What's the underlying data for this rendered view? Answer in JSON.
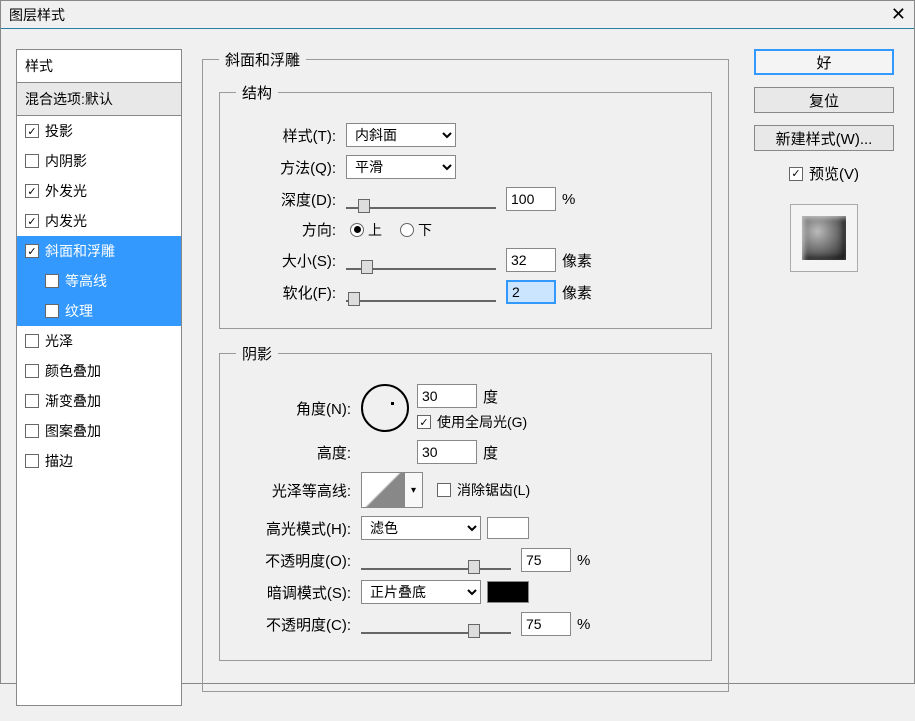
{
  "title": "图层样式",
  "stylesList": {
    "header": "样式",
    "blend": "混合选项:默认",
    "items": [
      {
        "label": "投影",
        "checked": true,
        "selected": false,
        "sub": false
      },
      {
        "label": "内阴影",
        "checked": false,
        "selected": false,
        "sub": false
      },
      {
        "label": "外发光",
        "checked": true,
        "selected": false,
        "sub": false
      },
      {
        "label": "内发光",
        "checked": true,
        "selected": false,
        "sub": false
      },
      {
        "label": "斜面和浮雕",
        "checked": true,
        "selected": true,
        "sub": false
      },
      {
        "label": "等高线",
        "checked": false,
        "selected": true,
        "sub": true
      },
      {
        "label": "纹理",
        "checked": false,
        "selected": true,
        "sub": true
      },
      {
        "label": "光泽",
        "checked": false,
        "selected": false,
        "sub": false
      },
      {
        "label": "颜色叠加",
        "checked": false,
        "selected": false,
        "sub": false
      },
      {
        "label": "渐变叠加",
        "checked": false,
        "selected": false,
        "sub": false
      },
      {
        "label": "图案叠加",
        "checked": false,
        "selected": false,
        "sub": false
      },
      {
        "label": "描边",
        "checked": false,
        "selected": false,
        "sub": false
      }
    ]
  },
  "bevel": {
    "title": "斜面和浮雕",
    "structure": {
      "title": "结构",
      "styleLabel": "样式(T):",
      "styleValue": "内斜面",
      "techLabel": "方法(Q):",
      "techValue": "平滑",
      "depthLabel": "深度(D):",
      "depthValue": "100",
      "depthUnit": "%",
      "directionLabel": "方向:",
      "upLabel": "上",
      "downLabel": "下",
      "sizeLabel": "大小(S):",
      "sizeValue": "32",
      "sizeUnit": "像素",
      "softLabel": "软化(F):",
      "softValue": "2",
      "softUnit": "像素"
    },
    "shading": {
      "title": "阴影",
      "angleLabel": "角度(N):",
      "angleValue": "30",
      "angleUnit": "度",
      "globalLabel": "使用全局光(G)",
      "altLabel": "高度:",
      "altValue": "30",
      "altUnit": "度",
      "contourLabel": "光泽等高线:",
      "antiLabel": "消除锯齿(L)",
      "hiLabel": "高光模式(H):",
      "hiValue": "滤色",
      "hiOpLabel": "不透明度(O):",
      "hiOpValue": "75",
      "shLabel": "暗调模式(S):",
      "shValue": "正片叠底",
      "shOpLabel": "不透明度(C):",
      "shOpValue": "75",
      "pct": "%"
    }
  },
  "buttons": {
    "ok": "好",
    "cancel": "复位",
    "newStyle": "新建样式(W)...",
    "preview": "预览(V)"
  }
}
